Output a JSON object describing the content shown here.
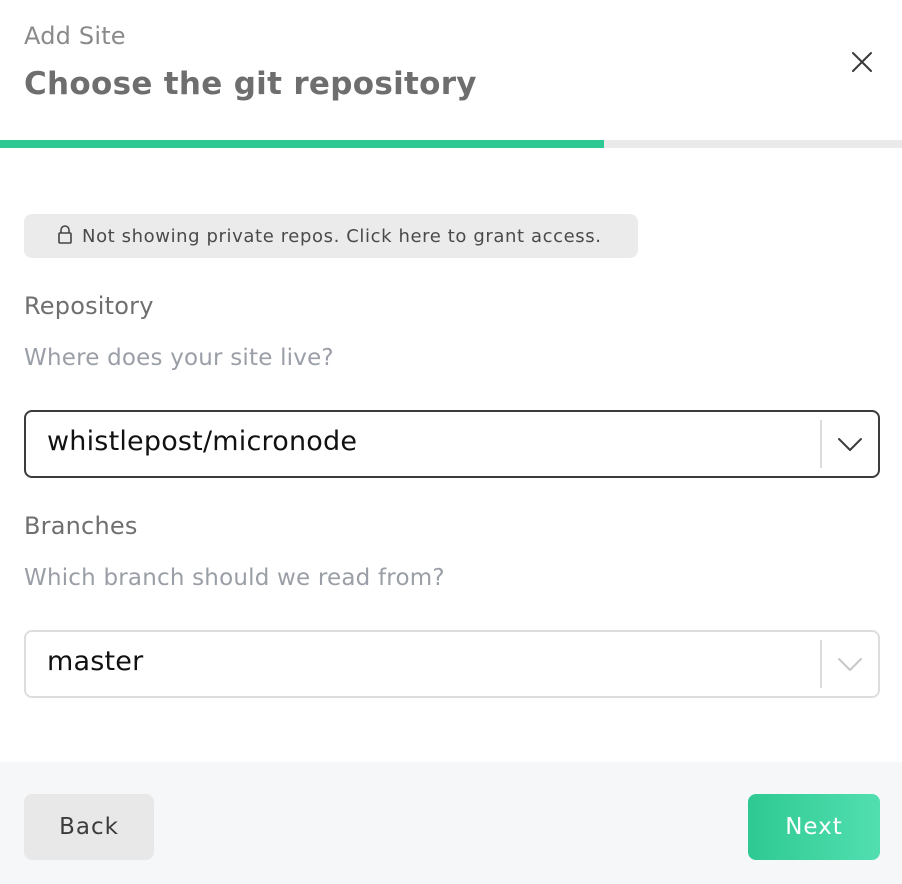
{
  "header": {
    "eyebrow": "Add Site",
    "title": "Choose the git repository",
    "close_icon": "close-icon"
  },
  "progress": {
    "fraction": 0.67,
    "fill_color": "#2ec992",
    "track_color": "#eaeaea"
  },
  "notice": {
    "icon": "lock-icon",
    "text": "Not showing private repos. Click here to grant access."
  },
  "repository": {
    "label": "Repository",
    "help": "Where does your site live?",
    "selected": "whistlepost/micronode",
    "icon": "chevron-down-icon"
  },
  "branches": {
    "label": "Branches",
    "help": "Which branch should we read from?",
    "selected": "master",
    "icon": "chevron-down-icon"
  },
  "footer": {
    "back_label": "Back",
    "next_label": "Next",
    "accent": "#2ec992"
  }
}
